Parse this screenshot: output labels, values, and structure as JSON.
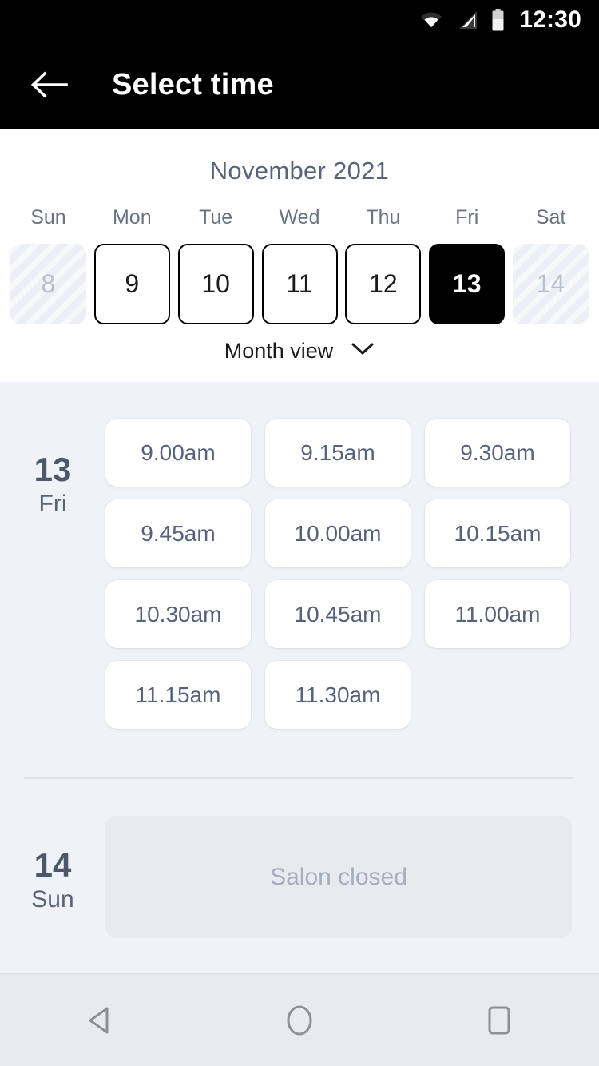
{
  "status_bar": {
    "time": "12:30",
    "icons": [
      "wifi-icon",
      "cell-signal-icon",
      "battery-icon"
    ]
  },
  "app_bar": {
    "back_label": "back-arrow-icon",
    "title": "Select time"
  },
  "calendar": {
    "month_label": "November 2021",
    "day_headers": [
      "Sun",
      "Mon",
      "Tue",
      "Wed",
      "Thu",
      "Fri",
      "Sat"
    ],
    "dates": [
      {
        "num": "8",
        "state": "disabled"
      },
      {
        "num": "9",
        "state": "available"
      },
      {
        "num": "10",
        "state": "available"
      },
      {
        "num": "11",
        "state": "available"
      },
      {
        "num": "12",
        "state": "available"
      },
      {
        "num": "13",
        "state": "selected"
      },
      {
        "num": "14",
        "state": "disabled"
      }
    ],
    "view_toggle": {
      "label": "Month view",
      "icon": "chevron-down-icon"
    }
  },
  "schedule": {
    "days": [
      {
        "day_number": "13",
        "day_name": "Fri",
        "closed": false,
        "slots": [
          "9.00am",
          "9.15am",
          "9.30am",
          "9.45am",
          "10.00am",
          "10.15am",
          "10.30am",
          "10.45am",
          "11.00am",
          "11.15am",
          "11.30am"
        ]
      },
      {
        "day_number": "14",
        "day_name": "Sun",
        "closed": true,
        "closed_label": "Salon closed",
        "slots": []
      }
    ]
  },
  "nav_bar": {
    "buttons": [
      "back-triangle-icon",
      "home-circle-icon",
      "recents-square-icon"
    ]
  },
  "colors": {
    "appbar_bg": "#000000",
    "calendar_bg": "#ffffff",
    "slots_bg": "#eff2f7",
    "selected_date_bg": "#000000",
    "text_dark": "#4c5769",
    "text_muted": "#6a7383",
    "closed_card_bg": "#e7eaef",
    "closed_text": "#a7aebd",
    "navbar_bg": "#e8eaed"
  }
}
